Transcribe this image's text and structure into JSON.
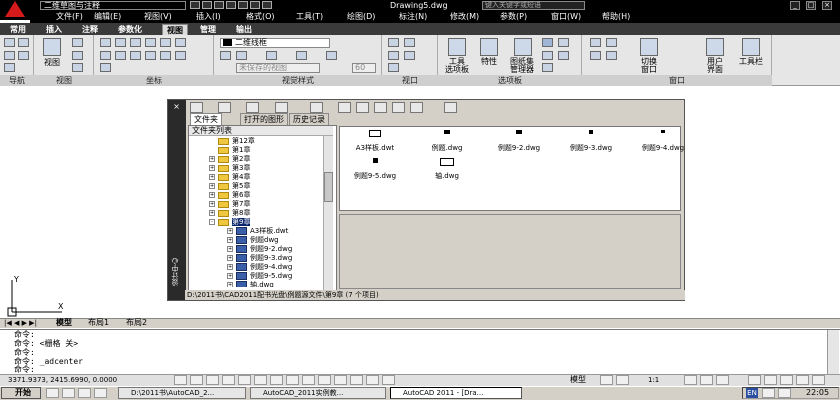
{
  "window": {
    "workspace": "二维草图与注释",
    "doc_title": "Drawing5.dwg",
    "search_placeholder": "键入关键字或短语"
  },
  "menu": [
    "文件(F)",
    "编辑(E)",
    "视图(V)",
    "插入(I)",
    "格式(O)",
    "工具(T)",
    "绘图(D)",
    "标注(N)",
    "修改(M)",
    "参数(P)",
    "窗口(W)",
    "帮助(H)"
  ],
  "ribbon_tabs": [
    "常用",
    "插入",
    "注释",
    "参数化",
    "视图",
    "管理",
    "输出"
  ],
  "ribbon_active": "视图",
  "ribbon": {
    "view_btn": "视图",
    "layer_dropdown": "二维线框",
    "unsaved": "未保存的视图",
    "zoom_value": "60",
    "buttons": {
      "tool_palette": [
        "工具",
        "选项板"
      ],
      "properties": "特性",
      "sheet_set": [
        "图纸集",
        "管理器"
      ],
      "switch_window": [
        "切换",
        "窗口"
      ],
      "user_interface": [
        "用户",
        "界面"
      ],
      "toolbar": "工具栏"
    },
    "panels": [
      "导航",
      "视图",
      "坐标",
      "视觉样式",
      "视口",
      "选项板",
      "窗口"
    ]
  },
  "design_center": {
    "side_title": "设计中心",
    "tabs": [
      "文件夹",
      "打开的图形",
      "历史记录"
    ],
    "active_tab": "文件夹",
    "tree_header": "文件夹列表",
    "tree": [
      {
        "label": "第12章",
        "type": "folder",
        "indent": 1,
        "expand": ""
      },
      {
        "label": "第1章",
        "type": "folder",
        "indent": 1,
        "expand": ""
      },
      {
        "label": "第2章",
        "type": "folder",
        "indent": 1,
        "expand": "+"
      },
      {
        "label": "第3章",
        "type": "folder",
        "indent": 1,
        "expand": "+"
      },
      {
        "label": "第4章",
        "type": "folder",
        "indent": 1,
        "expand": "+"
      },
      {
        "label": "第5章",
        "type": "folder",
        "indent": 1,
        "expand": "+"
      },
      {
        "label": "第6章",
        "type": "folder",
        "indent": 1,
        "expand": "+"
      },
      {
        "label": "第7章",
        "type": "folder",
        "indent": 1,
        "expand": "+"
      },
      {
        "label": "第8章",
        "type": "folder",
        "indent": 1,
        "expand": "+"
      },
      {
        "label": "第9章",
        "type": "folder",
        "indent": 1,
        "expand": "-",
        "selected": true
      },
      {
        "label": "A3样板.dwt",
        "type": "dwg",
        "indent": 2,
        "expand": "+"
      },
      {
        "label": "例题dwg",
        "type": "dwg",
        "indent": 2,
        "expand": "+"
      },
      {
        "label": "例题9-2.dwg",
        "type": "dwg",
        "indent": 2,
        "expand": "+"
      },
      {
        "label": "例题9-3.dwg",
        "type": "dwg",
        "indent": 2,
        "expand": "+"
      },
      {
        "label": "例题9-4.dwg",
        "type": "dwg",
        "indent": 2,
        "expand": "+"
      },
      {
        "label": "例题9-5.dwg",
        "type": "dwg",
        "indent": 2,
        "expand": "+"
      },
      {
        "label": "轴.dwg",
        "type": "dwg",
        "indent": 2,
        "expand": "+"
      }
    ],
    "files": [
      "A3样板.dwt",
      "例题.dwg",
      "例题9-2.dwg",
      "例题9-3.dwg",
      "例题9-4.dwg",
      "例题9-5.dwg",
      "轴.dwg"
    ],
    "status": "D:\\2011书\\CAD2011配书光盘\\例题源文件\\第9章 (7 个项目)"
  },
  "layout_tabs": [
    "模型",
    "布局1",
    "布局2"
  ],
  "command": [
    "命令:",
    "命令: <栅格 关>",
    "命令:",
    "命令: _adcenter",
    "命令:"
  ],
  "statusbar": {
    "coords": "3371.9373, 2415.6990, 0.0000",
    "model": "模型",
    "scale": "1:1"
  },
  "taskbar": {
    "start": "开始",
    "tasks": [
      "D:\\2011书\\AutoCAD_2...",
      "AutoCAD_2011实例教...",
      "AutoCAD 2011 - [Dra..."
    ],
    "active_task": 2,
    "lang": "EN",
    "time": "22:05"
  }
}
